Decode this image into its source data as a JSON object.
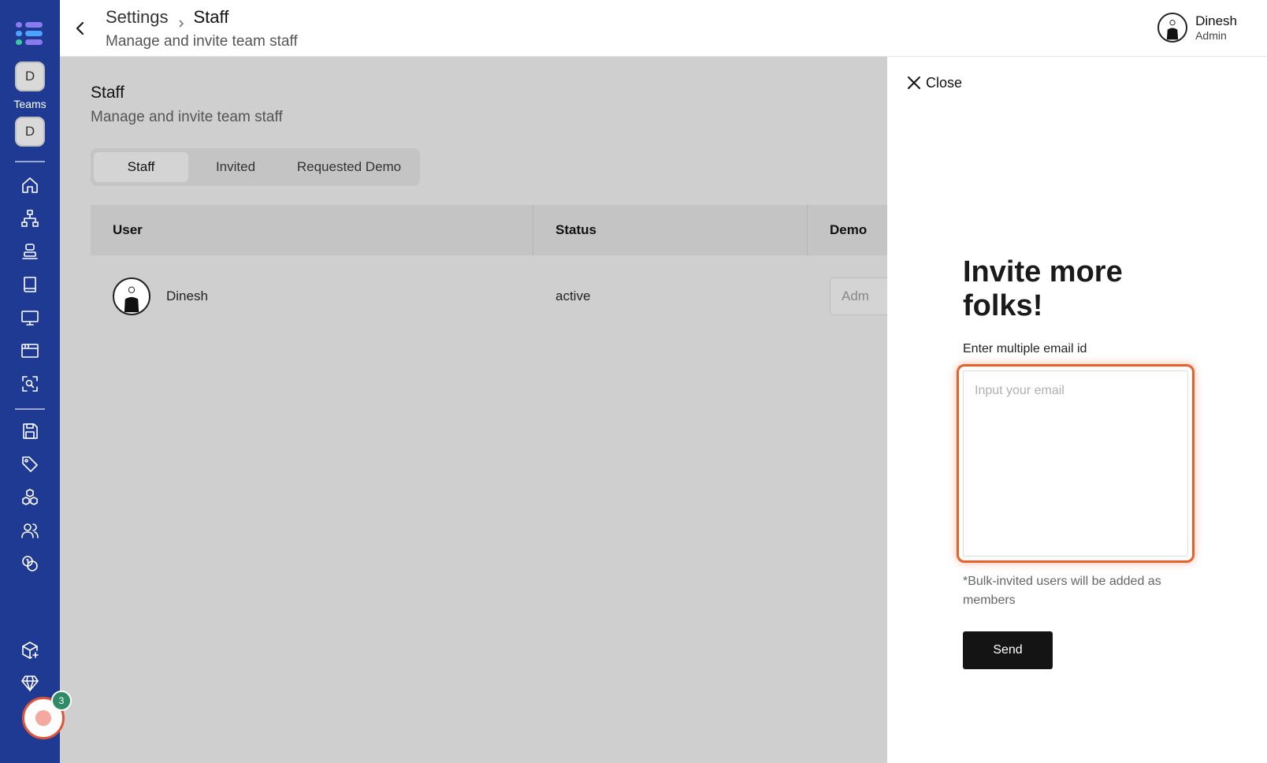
{
  "sidebar": {
    "team_badge_top": "D",
    "teams_label": "Teams",
    "team_badge_bottom": "D",
    "logo_colors": [
      "#8a7cf0",
      "#4da3ff",
      "#38c9a0"
    ],
    "nav_icons": [
      "home-icon",
      "org-chart-icon",
      "stack-icon",
      "book-icon",
      "monitor-icon",
      "browser-window-icon",
      "scan-search-icon",
      "save-icon",
      "tag-icon",
      "cubes-icon",
      "users-icon",
      "coins-icon",
      "package-plus-icon",
      "diamond-icon",
      "clipboard-icon"
    ]
  },
  "header": {
    "breadcrumb_parent": "Settings",
    "breadcrumb_current": "Staff",
    "subtitle": "Manage and invite team staff",
    "user_name": "Dinesh",
    "user_role": "Admin"
  },
  "main": {
    "title": "Staff",
    "subtitle": "Manage and invite team staff",
    "tabs": [
      {
        "label": "Staff",
        "active": true
      },
      {
        "label": "Invited",
        "active": false
      },
      {
        "label": "Requested Demo",
        "active": false
      }
    ],
    "table": {
      "columns": [
        "User",
        "Status",
        "Demo"
      ],
      "rows": [
        {
          "user": "Dinesh",
          "status": "active",
          "role_placeholder": "Adm"
        }
      ]
    }
  },
  "drawer": {
    "close_label": "Close",
    "title": "Invite more folks!",
    "email_label": "Enter multiple email id",
    "email_placeholder": "Input your email",
    "note": "*Bulk-invited users will be added as members",
    "send_label": "Send",
    "accent_color": "#e5622d"
  },
  "recorder": {
    "badge_count": "3"
  }
}
